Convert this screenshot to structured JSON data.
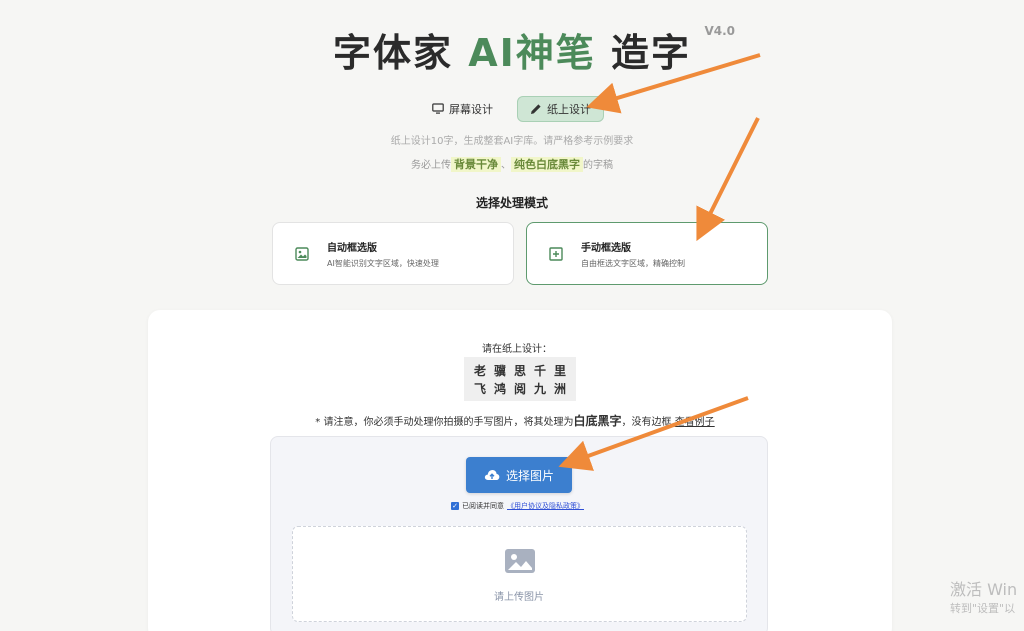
{
  "header": {
    "title_pre": "字体家 ",
    "title_accent": "AI神笔",
    "title_post": " 造字",
    "version": "V4.0"
  },
  "tabs": [
    {
      "label": "屏幕设计",
      "icon": "monitor-icon",
      "active": false
    },
    {
      "label": "纸上设计",
      "icon": "pencil-icon",
      "active": true
    }
  ],
  "hints": {
    "line1": "纸上设计10字，生成整套AI字库。请严格参考示例要求",
    "line2_pre": "务必上传",
    "line2_hl1": "背景干净",
    "line2_sep": "、",
    "line2_hl2": "纯色白底黑字",
    "line2_post": "的字稿"
  },
  "mode": {
    "title": "选择处理模式",
    "options": [
      {
        "name": "自动框选版",
        "desc": "AI智能识别文字区域，快速处理",
        "icon": "image-icon",
        "selected": false
      },
      {
        "name": "手动框选版",
        "desc": "自由框选文字区域，精确控制",
        "icon": "plus-square-icon",
        "selected": true
      }
    ]
  },
  "upload": {
    "design_label": "请在纸上设计：",
    "sample_chars": [
      "老",
      "骥",
      "思",
      "千",
      "里",
      "飞",
      "鸿",
      "阅",
      "九",
      "洲"
    ],
    "notice_pre": "* 请注意，你必须手动处理你拍摄的手写图片，将其处理为",
    "notice_bold": "白底黑字",
    "notice_mid": "，没有边框",
    "notice_link": "查看例子",
    "choose_button": "选择图片",
    "agree_text": "已阅读并同意",
    "agree_link": "《用户协议及隐私政策》",
    "drop_text": "请上传图片"
  },
  "watermark": {
    "line1": "激活 Win",
    "line2": "转到\"设置\"以"
  },
  "colors": {
    "accent_green": "#4c8a5a",
    "button_blue": "#3c7fcf",
    "arrow_orange": "#ef8a3a"
  }
}
